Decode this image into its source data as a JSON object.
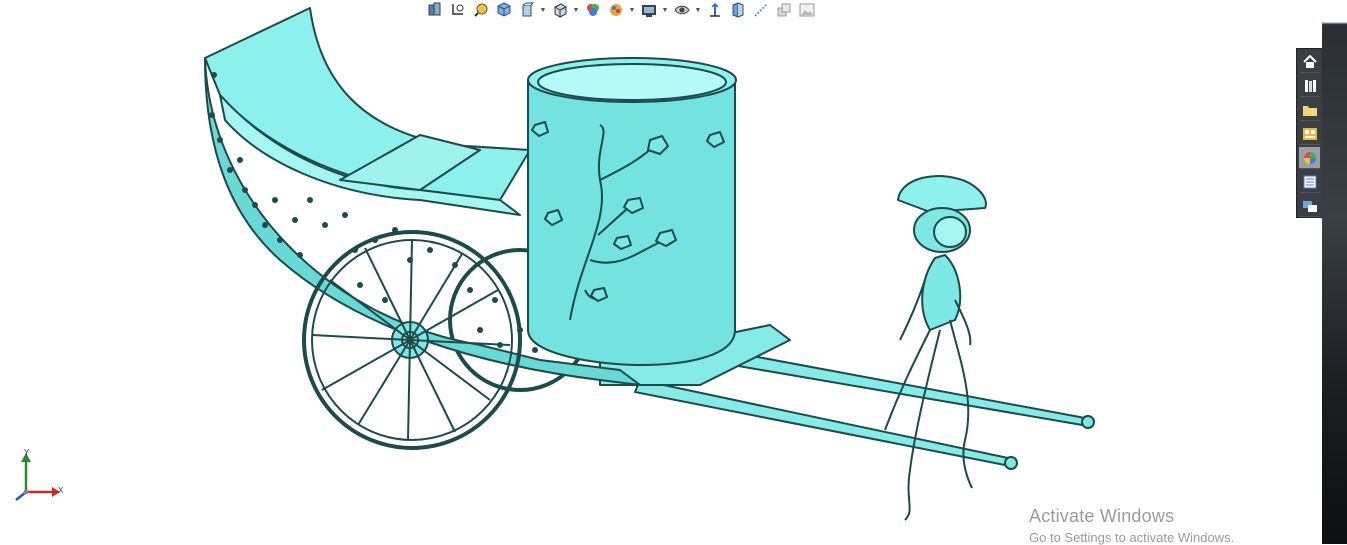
{
  "heads_up_toolbar": {
    "buttons": [
      {
        "icon": "zoom-to-fit-icon"
      },
      {
        "icon": "zoom-to-area-icon"
      },
      {
        "icon": "previous-view-icon"
      },
      {
        "icon": "section-view-icon"
      },
      {
        "icon": "view-orientation-icon",
        "dropdown": true
      },
      {
        "icon": "display-style-icon",
        "dropdown": true
      },
      {
        "icon": "hide-show-items-icon",
        "dropdown": true
      },
      {
        "icon": "edit-appearance-icon"
      },
      {
        "icon": "apply-scene-icon",
        "dropdown": true
      },
      {
        "icon": "view-settings-icon",
        "dropdown": true
      },
      {
        "icon": "rotate-view-icon",
        "dropdown": true
      },
      {
        "icon": "pan-icon"
      },
      {
        "icon": "split-view-icon"
      },
      {
        "icon": "sketch-icon"
      },
      {
        "icon": "layers-icon"
      },
      {
        "icon": "image-icon"
      }
    ]
  },
  "task_pane": {
    "items": [
      {
        "icon": "home-icon"
      },
      {
        "icon": "design-library-icon"
      },
      {
        "icon": "file-explorer-icon"
      },
      {
        "icon": "view-palette-icon"
      },
      {
        "icon": "appearances-icon",
        "active": true
      },
      {
        "icon": "custom-properties-icon"
      },
      {
        "icon": "forum-icon"
      }
    ]
  },
  "triad": {
    "x_label": "X",
    "y_label": "Y"
  },
  "watermark": {
    "title": "Activate Windows",
    "subtitle": "Go to Settings to activate Windows."
  },
  "colors": {
    "model_fill": "#7ee8e4",
    "model_stroke": "#1d4a4a",
    "background": "#ffffff"
  }
}
